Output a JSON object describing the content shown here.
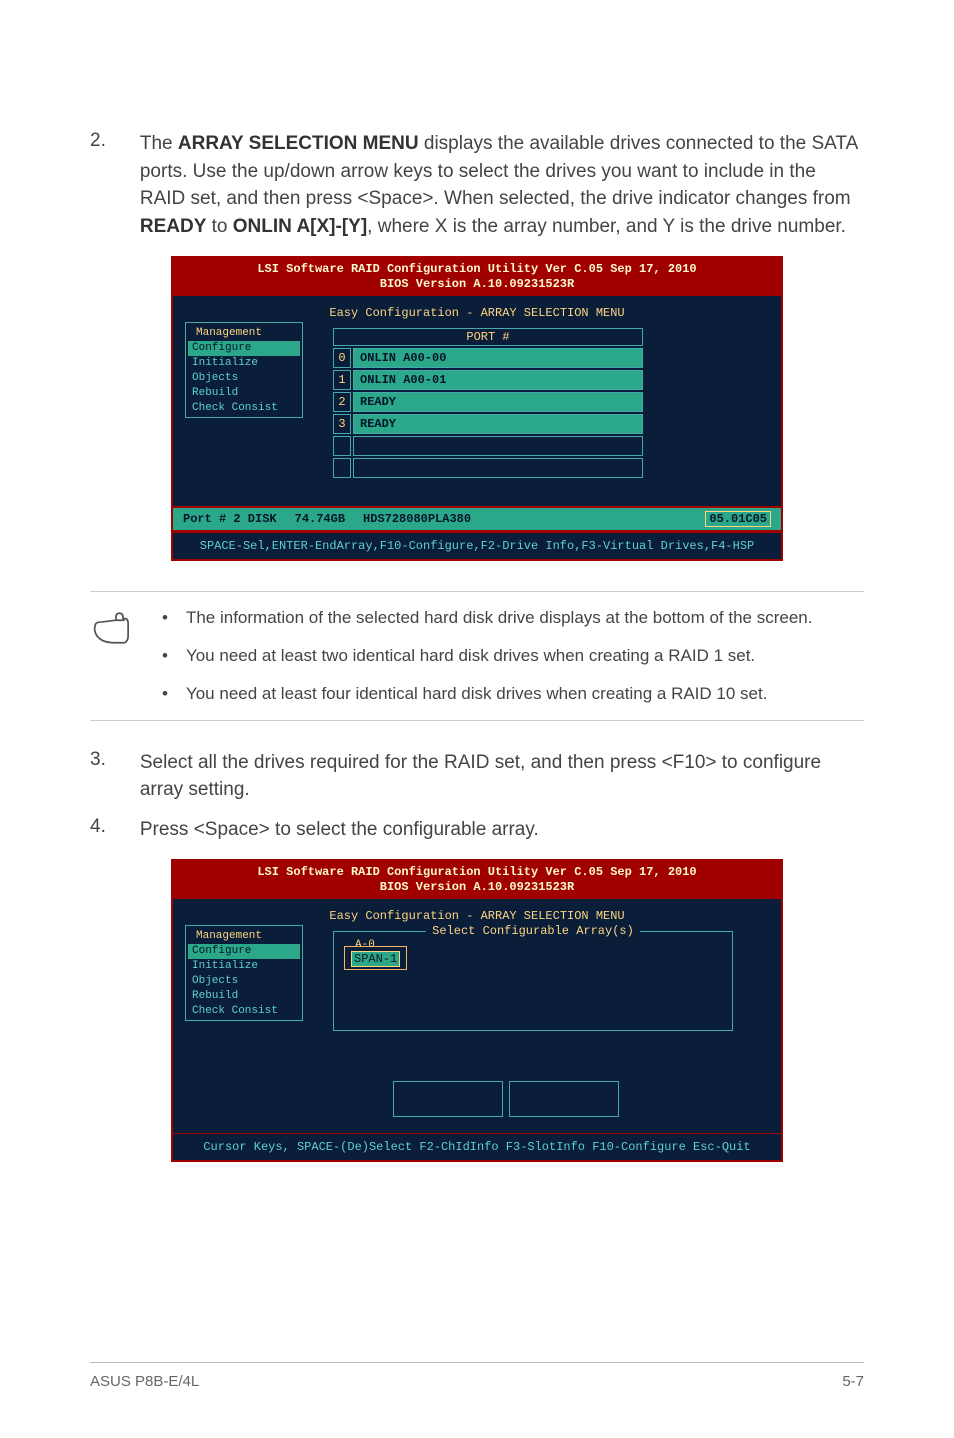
{
  "steps": {
    "s2": {
      "num": "2.",
      "text_plain_a": "The ",
      "bold_a": "ARRAY SELECTION MENU",
      "text_plain_b": " displays the available drives connected to the SATA ports. Use the up/down arrow keys to select the drives you want to include in the RAID set, and then press <Space>. When selected, the drive indicator changes from ",
      "bold_b": "READY",
      "text_plain_c": " to ",
      "bold_c": "ONLIN A[X]-[Y]",
      "text_plain_d": ", where X is the array number, and Y is the drive number."
    },
    "s3": {
      "num": "3.",
      "text": "Select all the drives required for the RAID set, and then press <F10> to configure array setting."
    },
    "s4": {
      "num": "4.",
      "text": "Press <Space> to select the configurable array."
    }
  },
  "bios1": {
    "title_line1": "LSI Software RAID Configuration Utility Ver C.05 Sep 17, 2010",
    "title_line2": "BIOS Version   A.10.09231523R",
    "sub": "Easy Configuration - ARRAY SELECTION MENU",
    "menu_title": "Management",
    "menu": [
      "Configure",
      "Initialize",
      "Objects",
      "Rebuild",
      "Check Consist"
    ],
    "port_header": "PORT #",
    "ports": [
      {
        "idx": "0",
        "label": "ONLIN A00-00",
        "teal": true
      },
      {
        "idx": "1",
        "label": "ONLIN A00-01",
        "teal": true
      },
      {
        "idx": "2",
        "label": "READY",
        "teal": true
      },
      {
        "idx": "3",
        "label": "READY",
        "teal": true
      },
      {
        "idx": "",
        "label": "",
        "teal": false
      },
      {
        "idx": "",
        "label": "",
        "teal": false
      }
    ],
    "disk_port": "Port # 2 DISK",
    "disk_size": "74.74GB",
    "disk_model": "HDS728080PLA380",
    "disk_code": "05.01C05",
    "foot": "SPACE-Sel,ENTER-EndArray,F10-Configure,F2-Drive Info,F3-Virtual Drives,F4-HSP"
  },
  "notes": {
    "n1": "The information of the selected hard disk drive displays at the bottom of the screen.",
    "n2": "You need at least two identical hard disk drives when creating a RAID 1 set.",
    "n3": "You need at least four identical hard disk drives when creating a RAID 10 set."
  },
  "bios2": {
    "title_line1": "LSI Software RAID Configuration Utility Ver C.05 Sep 17, 2010",
    "title_line2": "BIOS Version   A.10.09231523R",
    "sub": "Easy Configuration - ARRAY SELECTION MENU",
    "inner_sub": "Select Configurable Array(s)",
    "menu_title": "Management",
    "menu": [
      "Configure",
      "Initialize",
      "Objects",
      "Rebuild",
      "Check Consist"
    ],
    "span_head": "A-0",
    "span_val": "SPAN-1",
    "foot": "Cursor Keys, SPACE-(De)Select F2-ChIdInfo F3-SlotInfo F10-Configure Esc-Quit"
  },
  "footer": {
    "left": "ASUS P8B-E/4L",
    "right": "5-7"
  }
}
